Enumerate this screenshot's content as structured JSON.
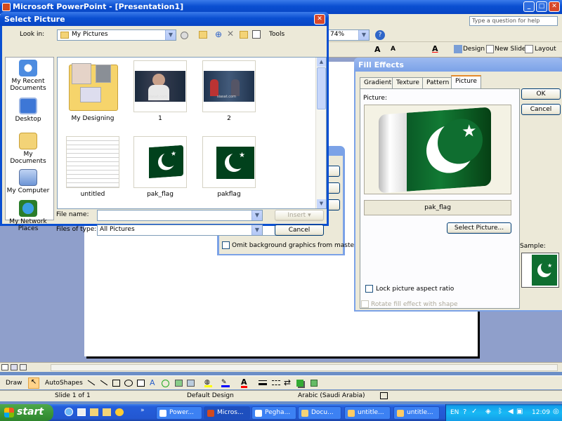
{
  "app": {
    "title": "Microsoft PowerPoint - [Presentation1]",
    "help_placeholder": "Type a question for help",
    "zoom": "74%"
  },
  "toolbar": {
    "design": "Design",
    "new_slide": "New Slide",
    "layout": "Layout"
  },
  "draw_bar": {
    "draw": "Draw",
    "autoshapes": "AutoShapes"
  },
  "status": {
    "slide": "Slide 1 of 1",
    "design": "Default Design",
    "language": "Arabic (Saudi Arabia)"
  },
  "taskbar": {
    "start": "start",
    "tasks": [
      "Power...",
      "Micros...",
      "Pegha...",
      "Docu...",
      "untitle...",
      "untitle..."
    ],
    "lang": "EN",
    "clock": "12:09 "
  },
  "select_picture": {
    "title": "Select Picture",
    "look_in_label": "Look in:",
    "look_in_value": "My Pictures",
    "tools": "Tools",
    "places": [
      "My Recent Documents",
      "Desktop",
      "My Documents",
      "My Computer",
      "My Network Places"
    ],
    "files": [
      "My Designing",
      "1",
      "2",
      "untitled",
      "pak_flag",
      "pakflag"
    ],
    "thumb_caption": "siasat.com",
    "file_name_label": "File name:",
    "file_name_value": "",
    "files_of_type_label": "Files of type:",
    "files_of_type_value": "All Pictures",
    "insert": "Insert",
    "cancel": "Cancel"
  },
  "bg_dialog": {
    "omit_label": "Omit background graphics from master"
  },
  "fill_effects": {
    "title": "Fill Effects",
    "tabs": [
      "Gradient",
      "Texture",
      "Pattern",
      "Picture"
    ],
    "picture_label": "Picture:",
    "picture_name": "pak_flag",
    "select_picture": "Select Picture...",
    "lock_aspect": "Lock picture aspect ratio",
    "rotate": "Rotate fill effect with shape",
    "sample_label": "Sample:",
    "ok": "OK",
    "cancel": "Cancel"
  },
  "colors": {
    "flag_green": "#01411c",
    "xp_blue": "#0a4fd1",
    "dialog_face": "#ece9d8"
  }
}
